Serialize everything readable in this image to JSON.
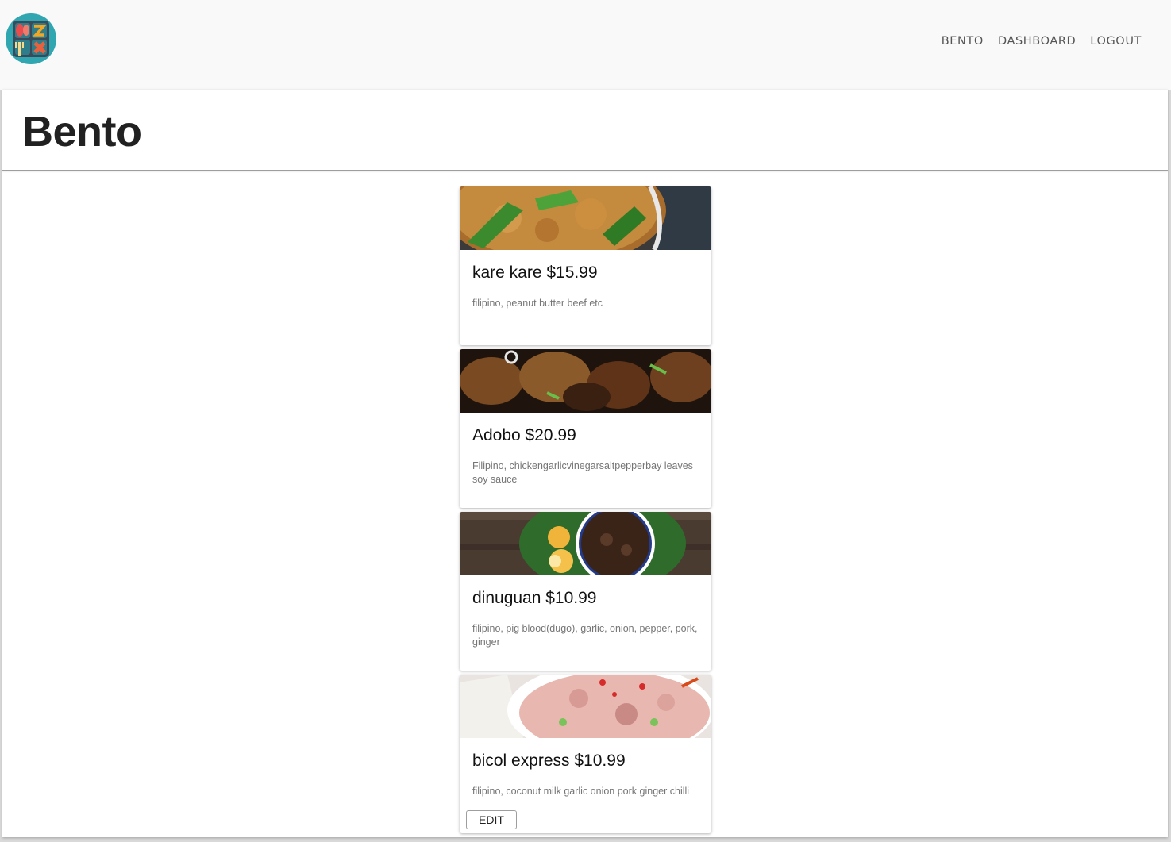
{
  "nav": {
    "logo_icon": "bento-box-icon",
    "links": [
      "BENTO",
      "DASHBOARD",
      "LOGOUT"
    ]
  },
  "page": {
    "title": "Bento"
  },
  "dishes": [
    {
      "title": "kare kare $15.99",
      "description": "filipino, peanut butter beef etc",
      "image": "kare-kare-photo"
    },
    {
      "title": "Adobo $20.99",
      "description": "Filipino, chickengarlicvinegarsaltpepperbay leaves soy sauce",
      "image": "adobo-photo"
    },
    {
      "title": "dinuguan $10.99",
      "description": "filipino, pig blood(dugo), garlic, onion, pepper, pork, ginger",
      "image": "dinuguan-photo"
    },
    {
      "title": "bicol express $10.99",
      "description": "filipino, coconut milk garlic onion pork ginger chilli",
      "image": "bicol-express-photo",
      "action": "EDIT"
    }
  ]
}
